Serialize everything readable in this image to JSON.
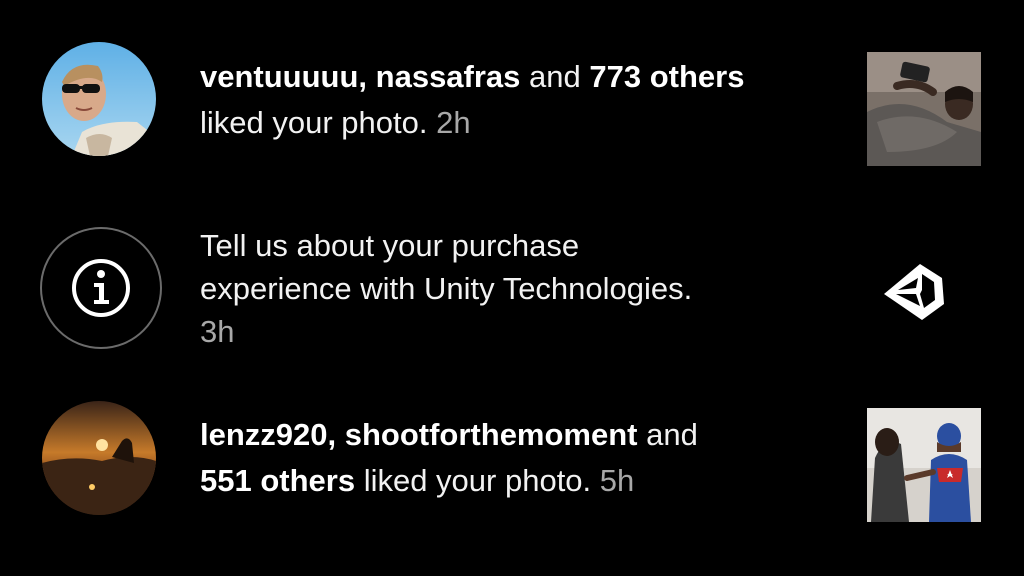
{
  "notifications": [
    {
      "users": "ventuuuuu, nassafras",
      "connector": " and ",
      "others": "773 others",
      "action": "liked your photo.",
      "time": "2h",
      "avatar_icon": "user-avatar-sunglasses",
      "thumb_icon": "photo-thumbnail-person-on-couch"
    },
    {
      "line1": "Tell us about your purchase",
      "line2": "experience with Unity Technologies.",
      "time": "3h",
      "avatar_icon": "info-icon",
      "thumb_icon": "unity-logo-icon"
    },
    {
      "users": "lenzz920, shootforthemoment",
      "connector": " and",
      "others": "551 others",
      "action": " liked your photo.",
      "time": "5h",
      "avatar_icon": "user-avatar-sunset",
      "thumb_icon": "photo-thumbnail-captain-america"
    }
  ],
  "colors": {
    "background": "#000000",
    "text": "#f2f2f2",
    "time": "#a8a8a8",
    "icon_ring": "#6b6b6b"
  }
}
